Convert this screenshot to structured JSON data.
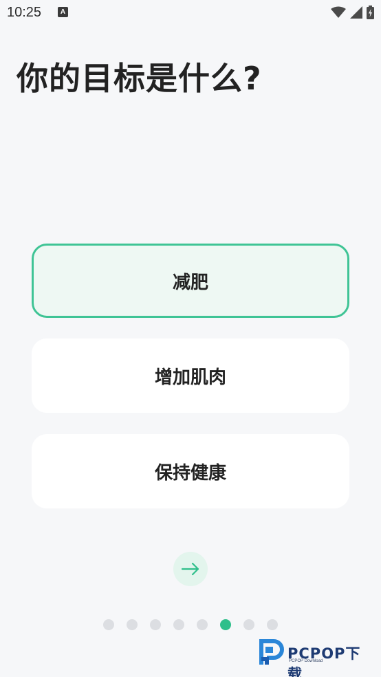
{
  "status_bar": {
    "time": "10:25",
    "app_icon_letter": "A",
    "icons": [
      "wifi-icon",
      "signal-icon",
      "battery-charging-icon"
    ]
  },
  "title": "你的目标是什么?",
  "options": [
    {
      "label": "减肥",
      "selected": true
    },
    {
      "label": "增加肌肉",
      "selected": false
    },
    {
      "label": "保持健康",
      "selected": false
    }
  ],
  "next_button": {
    "icon": "arrow-right-icon"
  },
  "pagination": {
    "total": 8,
    "current": 6
  },
  "watermark": {
    "brand": "PCPOP下载",
    "sub": "PCPOP Download"
  },
  "colors": {
    "accent": "#2fbf8b",
    "selected_border": "#3fc495",
    "selected_bg": "#eef8f3",
    "background": "#f6f7f9"
  }
}
